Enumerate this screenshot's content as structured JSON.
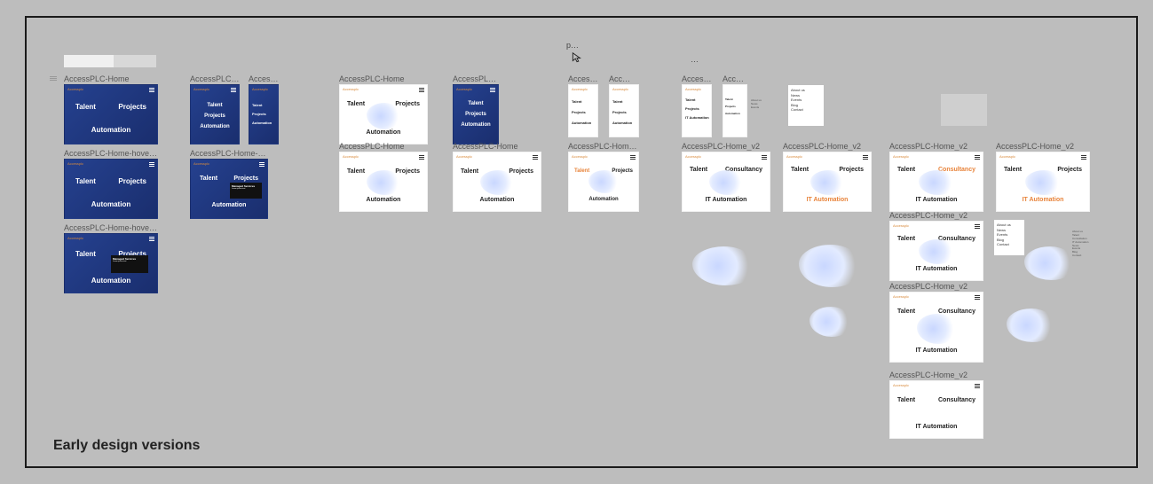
{
  "caption": "Early design versions",
  "top_labels": {
    "p": "p…",
    "ellipsis": "…"
  },
  "brand": "Accessplc",
  "words": {
    "talent": "Talent",
    "projects": "Projects",
    "automation": "Automation",
    "it_automation": "IT Automation",
    "consultancy": "Consultancy"
  },
  "menu_card": {
    "about": "About us",
    "news": "News",
    "events": "Events",
    "blog": "Blog",
    "contact": "Contact"
  },
  "menu_card2": {
    "about": "About us",
    "talent": "Talent",
    "consultation": "Consultation",
    "it_automation": "IT Automation",
    "news": "News",
    "events": "Events",
    "blog": "Blog",
    "contact": "Contact"
  },
  "hover": {
    "title": "Managed Services",
    "body": "Lorem ipsum text"
  },
  "frames": {
    "home": "AccessPLC-Home",
    "home_hover": "AccessPLC-Home-hove…",
    "access_trunc": "Access…",
    "acc_trunc": "Acc…",
    "home_v2": "AccessPLC-Home_v2"
  }
}
